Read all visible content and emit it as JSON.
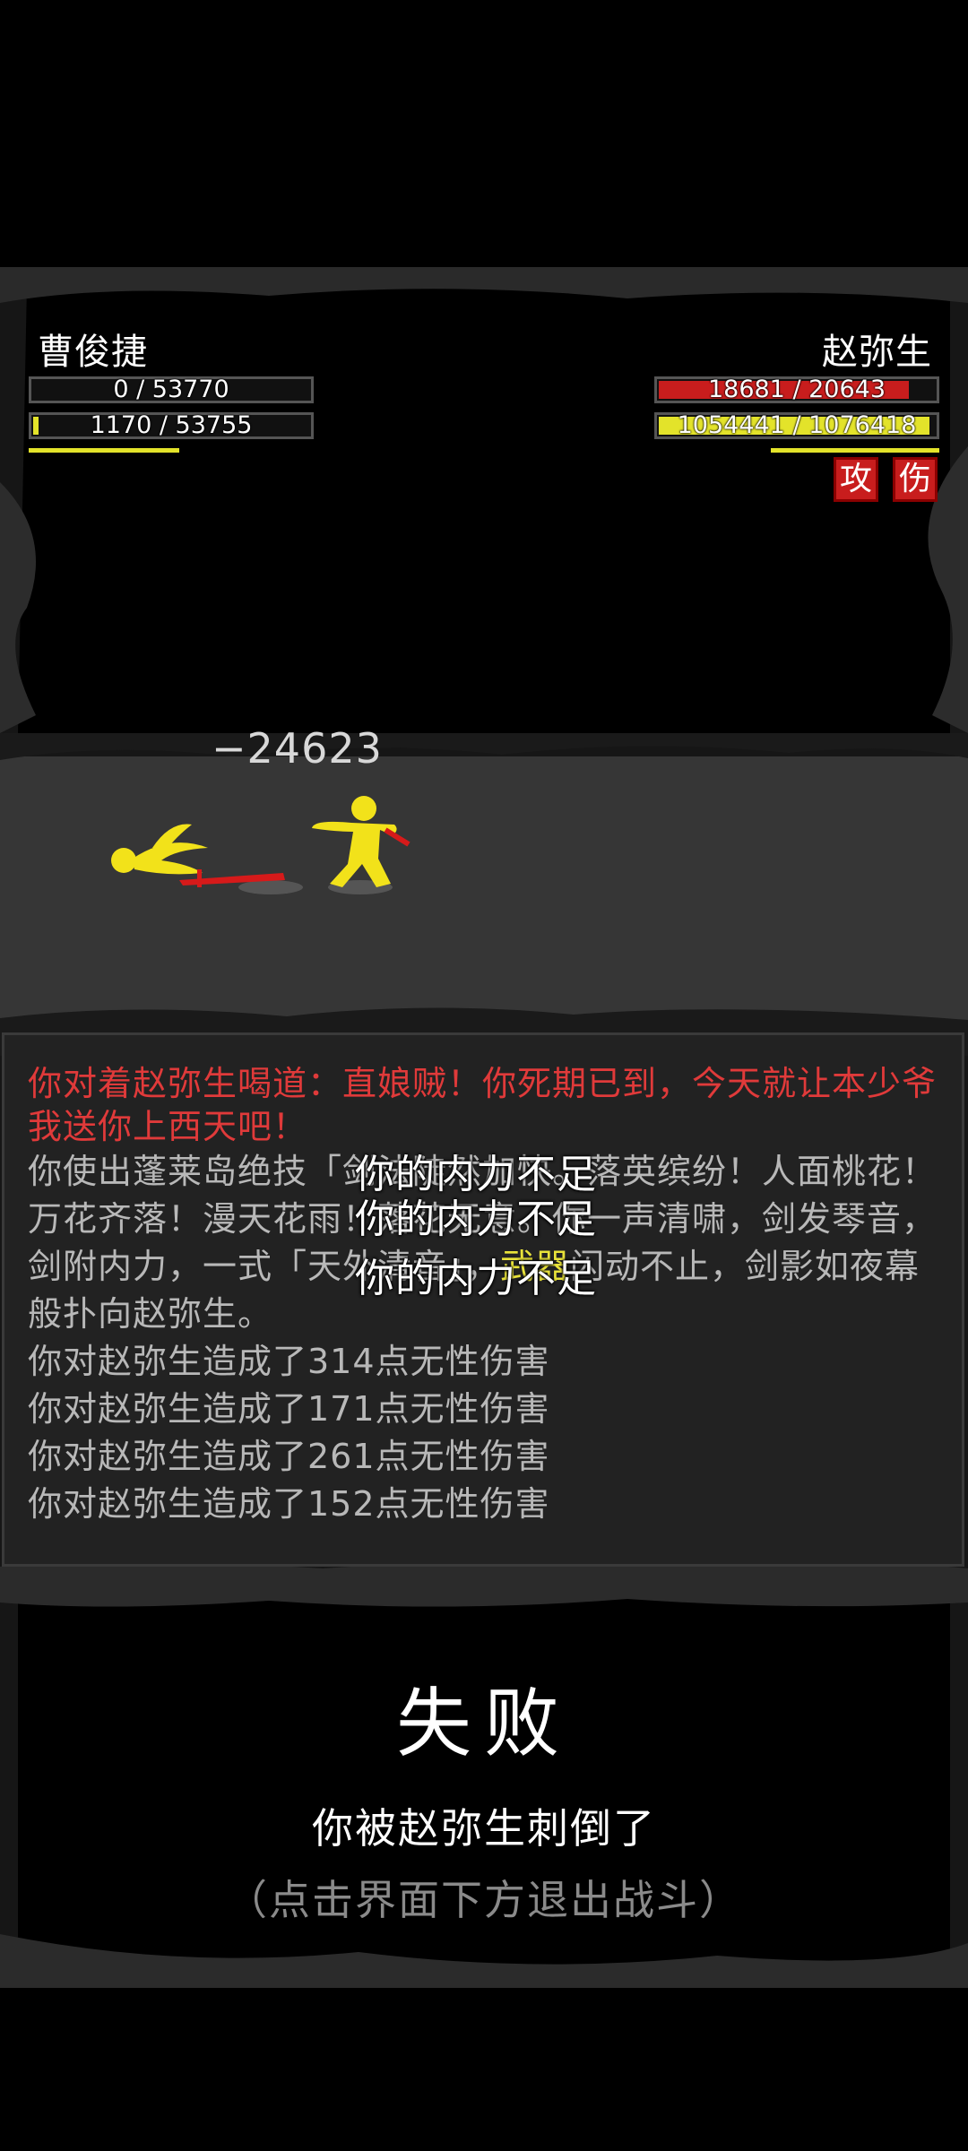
{
  "player": {
    "name": "曹俊捷",
    "hp_text": "0 / 53770",
    "mp_text": "1170 / 53755",
    "hp_fraction": 0.0,
    "mp_fraction": 0.02
  },
  "enemy": {
    "name": "赵弥生",
    "hp_text": "18681 / 20643",
    "mp_text": "1054441 / 1076418",
    "hp_fraction": 0.905,
    "mp_fraction": 0.98,
    "tags": [
      "攻",
      "伤"
    ]
  },
  "damage_number": "−24623",
  "log": {
    "shout": "你对着赵弥生喝道：直娘贼！你死期已到，今天就让本少爷我送你上西天吧！",
    "skill_part1": "你使出蓬莱岛绝技「",
    "skill_hidden": "",
    "skill_part2": "剑法陡然加快。落英缤纷！人面桃花！万花齐落！漫天花雨！落花无意。你一声清啸，剑发琴音，",
    "skill_part3": "剑附内力，一式「天外清音」，",
    "weapon": "武器",
    "skill_part4": "闪动不止，剑影如夜幕般扑向赵弥生。",
    "damage_lines": [
      "你对赵弥生造成了314点无性伤害",
      "你对赵弥生造成了171点无性伤害",
      "你对赵弥生造成了261点无性伤害",
      "你对赵弥生造成了152点无性伤害"
    ]
  },
  "overlay_messages": [
    "你的内力不足",
    "你的内力不足",
    "你的内力不足"
  ],
  "result": {
    "title": "失败",
    "description": "你被赵弥生刺倒了",
    "hint": "（点击界面下方退出战斗）"
  },
  "colors": {
    "hp_bar": "#c81d1d",
    "mp_bar": "#e3e32a",
    "character": "#f2e21a",
    "weapon": "#d61a1a",
    "shout_text": "#e03a3a"
  }
}
